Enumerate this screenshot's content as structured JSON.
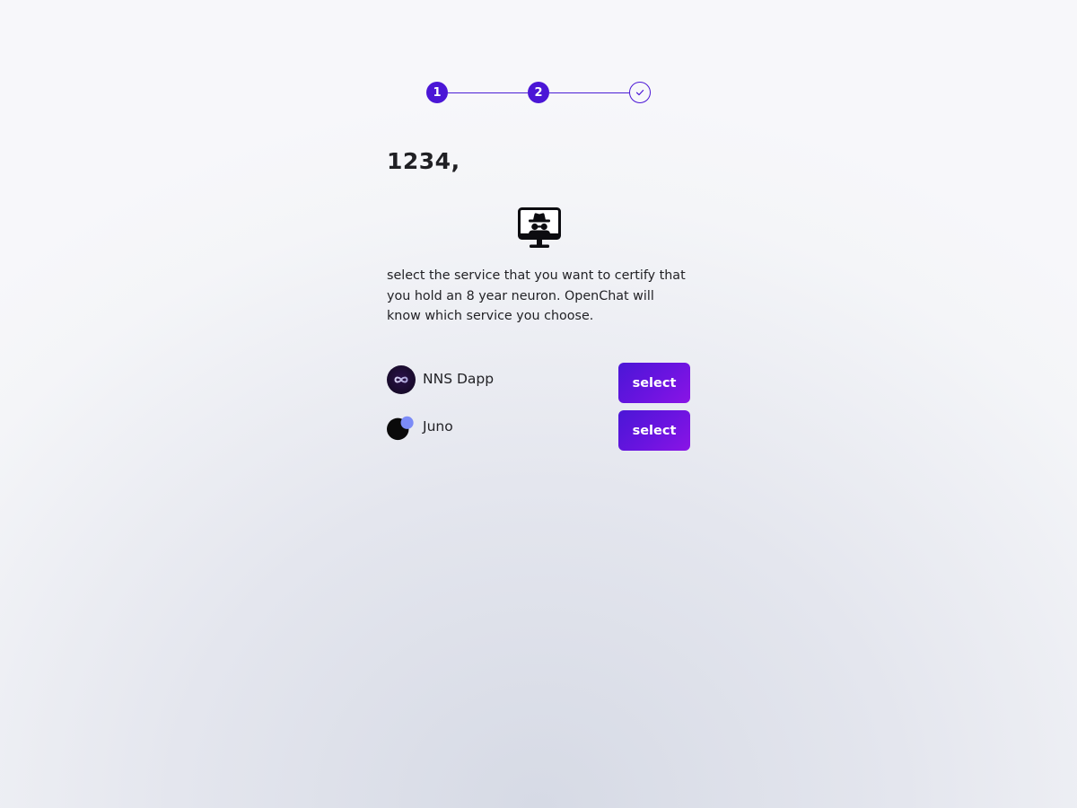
{
  "stepper": {
    "steps": [
      {
        "label": "1",
        "state": "complete"
      },
      {
        "label": "2",
        "state": "current"
      },
      {
        "label": "",
        "icon": "check-icon",
        "state": "pending"
      }
    ],
    "accent_color": "#4b16d6"
  },
  "greeting": "1234,",
  "hero_icon": "incognito-monitor-icon",
  "description": "select the service that you want to certify that you hold an 8 year neuron. OpenChat will know which service you choose.",
  "providers": [
    {
      "name": "NNS Dapp",
      "icon": "nns-infinity-logo-icon",
      "button_label": "select"
    },
    {
      "name": "Juno",
      "icon": "juno-logo-icon",
      "button_label": "select"
    }
  ],
  "colors": {
    "button_gradient_start": "#4b16d6",
    "button_gradient_end": "#8a14e6",
    "text": "#222226"
  }
}
